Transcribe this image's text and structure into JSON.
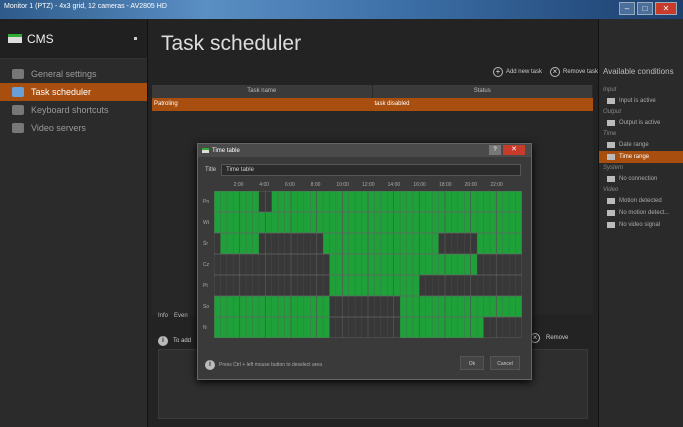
{
  "window_title": "Monitor 1 (PTZ) - 4x3 grid, 12 cameras - AV2805 HD",
  "sidebar": {
    "title": "CMS",
    "items": [
      {
        "label": "General settings"
      },
      {
        "label": "Task scheduler"
      },
      {
        "label": "Keyboard shortcuts"
      },
      {
        "label": "Video servers"
      }
    ]
  },
  "main": {
    "title": "Task scheduler",
    "add_task": "Add new task",
    "remove_task": "Remove task",
    "columns": [
      "Task name",
      "Status"
    ],
    "row": {
      "name": "Patroling",
      "status": "task disabled"
    },
    "tabs": [
      "Info",
      "Even"
    ],
    "detail_hint": "To add",
    "modify": "ify",
    "remove": "Remove"
  },
  "conditions": {
    "title": "Available conditions",
    "groups": [
      {
        "label": "Input",
        "items": [
          "Input is active"
        ]
      },
      {
        "label": "Output",
        "items": [
          "Output is active"
        ]
      },
      {
        "label": "Time",
        "items": [
          "Date range",
          "Time range"
        ]
      },
      {
        "label": "System",
        "items": [
          "No connection"
        ]
      },
      {
        "label": "Video",
        "items": [
          "Motion detected",
          "No motion detect...",
          "No video signal"
        ]
      }
    ]
  },
  "dialog": {
    "title": "Time table",
    "field_label": "Title",
    "field_value": "Time table",
    "hours": [
      "2:00",
      "4:00",
      "6:00",
      "8:00",
      "10:00",
      "12:00",
      "14:00",
      "16:00",
      "18:00",
      "20:00",
      "22:00"
    ],
    "days": [
      "Pn",
      "Wt",
      "Śr",
      "Cz",
      "Pt",
      "So",
      "N"
    ],
    "hint": "Press Ctrl + left mouse button to deselect area",
    "ok": "Ok",
    "cancel": "Cancel",
    "help": "?",
    "close": "✕"
  },
  "schedule_hours_active": [
    [
      [
        0,
        7
      ],
      [
        9,
        48
      ]
    ],
    [
      [
        0,
        48
      ]
    ],
    [
      [
        1,
        7
      ],
      [
        17,
        35
      ],
      [
        41,
        48
      ]
    ],
    [
      [
        18,
        41
      ]
    ],
    [
      [
        18,
        32
      ]
    ],
    [
      [
        0,
        18
      ],
      [
        29,
        48
      ]
    ],
    [
      [
        0,
        18
      ],
      [
        29,
        42
      ]
    ]
  ],
  "colors": {
    "accent": "#a84f10",
    "grid_on": "#1fa13a",
    "grid_off": "#383838"
  }
}
